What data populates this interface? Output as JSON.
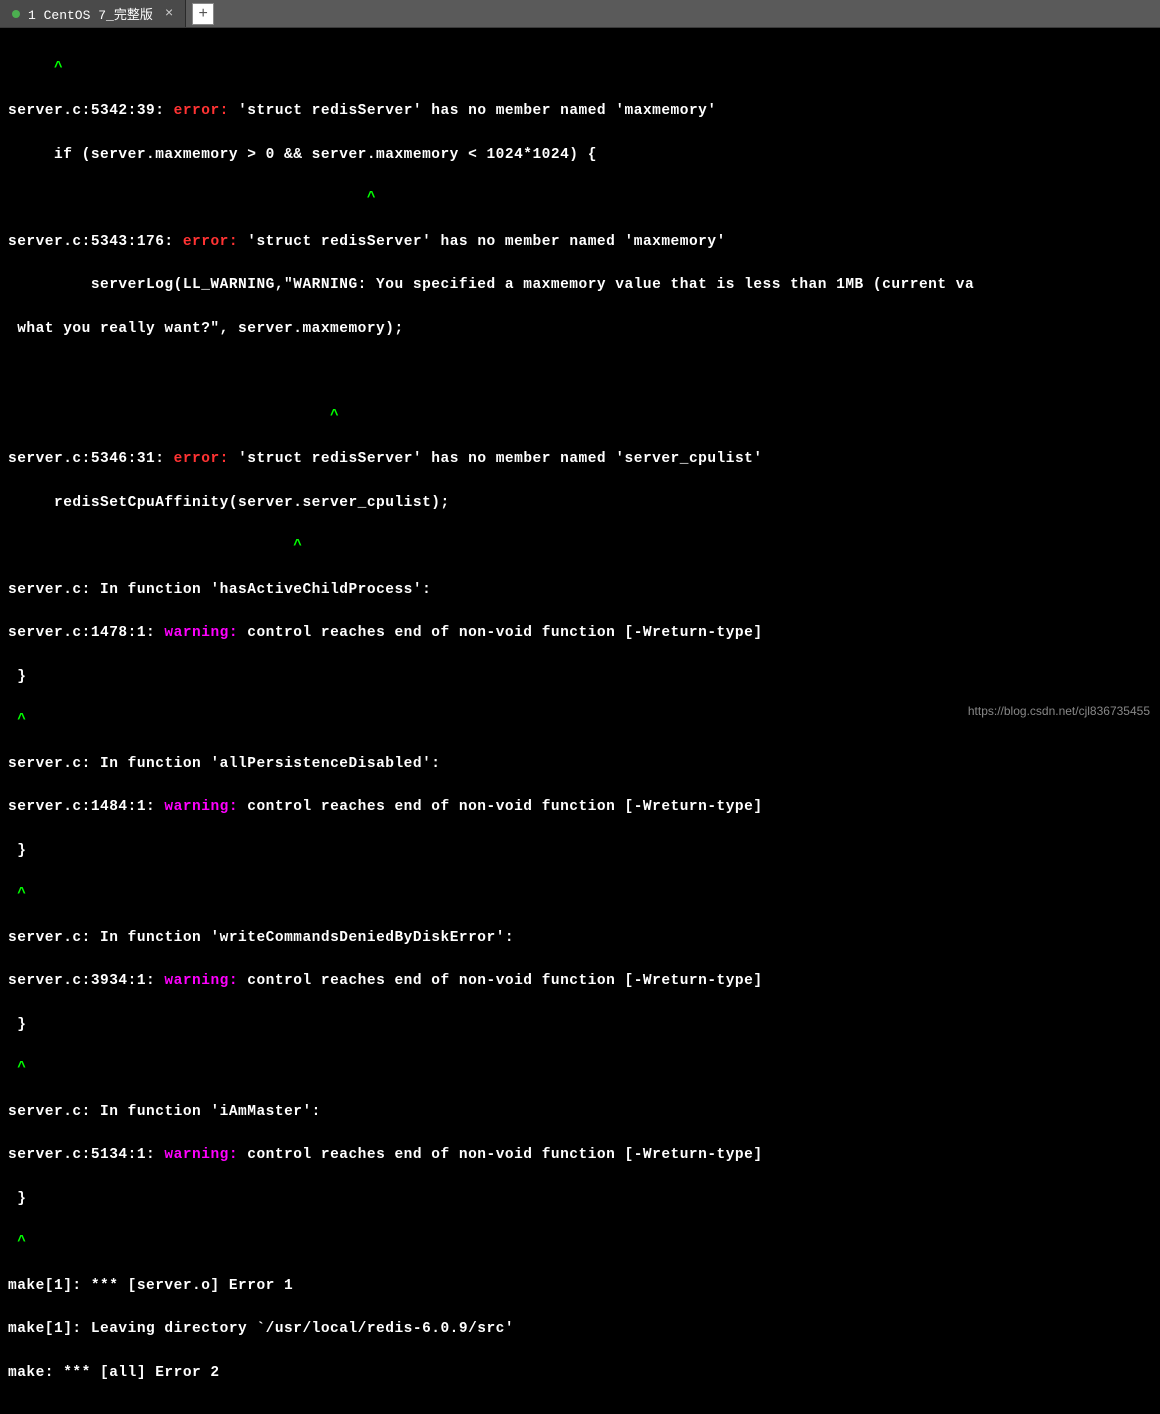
{
  "tab": {
    "title": "1 CentOS 7_完整版",
    "close": "×",
    "add": "+"
  },
  "lines": {
    "caret_single": "     ^",
    "e1_loc": "server.c:5342:39:",
    "e1_err": " error: ",
    "e1_msg1": "'",
    "e1_bold1": "struct redisServer",
    "e1_msg2": "' has no member named '",
    "e1_bold2": "maxmemory",
    "e1_msg3": "'",
    "e1_code": "     if (server.maxmemory > 0 && server.maxmemory < 1024*1024) {",
    "e1_caret": "                                       ^",
    "e2_loc": "server.c:5343:176:",
    "e2_err": " error: ",
    "e2_msg1": "'",
    "e2_bold1": "struct redisServer",
    "e2_msg2": "' has no member named '",
    "e2_bold2": "maxmemory",
    "e2_msg3": "'",
    "e2_code": "         serverLog(LL_WARNING,\"WARNING: You specified a maxmemory value that is less than 1MB (current va",
    "e2_code2": " what you really want?\", server.maxmemory);",
    "e2_caret": "                                   ^",
    "e3_loc": "server.c:5346:31:",
    "e3_err": " error: ",
    "e3_msg1": "'",
    "e3_bold1": "struct redisServer",
    "e3_msg2": "' has no member named '",
    "e3_bold2": "server_cpulist",
    "e3_msg3": "'",
    "e3_code": "     redisSetCpuAffinity(server.server_cpulist);",
    "e3_caret": "                               ^",
    "f1_loc": "server.c:",
    "f1_msg1": " In function '",
    "f1_bold": "hasActiveChildProcess",
    "f1_msg2": "':",
    "w1_loc": "server.c:1478:1:",
    "w1_warn": " warning: ",
    "w1_msg": "control reaches end of non-void function [-Wreturn-type]",
    "brace": " }",
    "brace_caret": " ^",
    "f2_loc": "server.c:",
    "f2_msg1": " In function '",
    "f2_bold": "allPersistenceDisabled",
    "f2_msg2": "':",
    "w2_loc": "server.c:1484:1:",
    "w2_warn": " warning: ",
    "w2_msg": "control reaches end of non-void function [-Wreturn-type]",
    "f3_loc": "server.c:",
    "f3_msg1": " In function '",
    "f3_bold": "writeCommandsDeniedByDiskError",
    "f3_msg2": "':",
    "w3_loc": "server.c:3934:1:",
    "w3_warn": " warning: ",
    "w3_msg": "control reaches end of non-void function [-Wreturn-type]",
    "f4_loc": "server.c:",
    "f4_msg1": " In function '",
    "f4_bold": "iAmMaster",
    "f4_msg2": "':",
    "w4_loc": "server.c:5134:1:",
    "w4_warn": " warning: ",
    "w4_msg": "control reaches end of non-void function [-Wreturn-type]",
    "make1": "make[1]: *** [server.o] Error 1",
    "make2": "make[1]: Leaving directory `/usr/local/redis-6.0.9/src'",
    "make3": "make: *** [all] Error 2"
  },
  "watermark": "https://blog.csdn.net/cjl836735455"
}
